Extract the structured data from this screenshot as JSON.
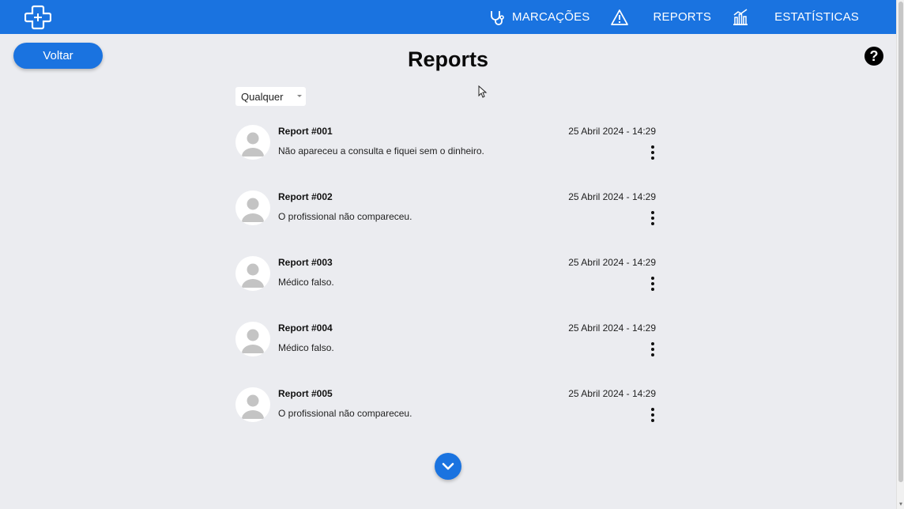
{
  "header": {
    "nav": [
      {
        "label": "MARCAÇÕES",
        "icon": "stethoscope-icon"
      },
      {
        "label": "",
        "icon": "warning-icon"
      },
      {
        "label": "REPORTS",
        "icon": ""
      },
      {
        "label": "",
        "icon": "bar-chart-icon"
      },
      {
        "label": "ESTATÍSTICAS",
        "icon": ""
      }
    ],
    "brand_color": "#1a73e0"
  },
  "back_label": "Voltar",
  "page_title": "Reports",
  "help_label": "?",
  "filter": {
    "selected": "Qualquer"
  },
  "reports": [
    {
      "title": "Report #001",
      "text": "Não apareceu a consulta e fiquei sem o dinheiro.",
      "date": "25 Abril 2024 - 14:29"
    },
    {
      "title": "Report #002",
      "text": "O profissional não compareceu.",
      "date": "25 Abril 2024 - 14:29"
    },
    {
      "title": "Report #003",
      "text": "Médico falso.",
      "date": "25 Abril 2024 - 14:29"
    },
    {
      "title": "Report #004",
      "text": "Médico falso.",
      "date": "25 Abril 2024 - 14:29"
    },
    {
      "title": "Report #005",
      "text": "O profissional não compareceu.",
      "date": "25 Abril 2024 - 14:29"
    }
  ]
}
